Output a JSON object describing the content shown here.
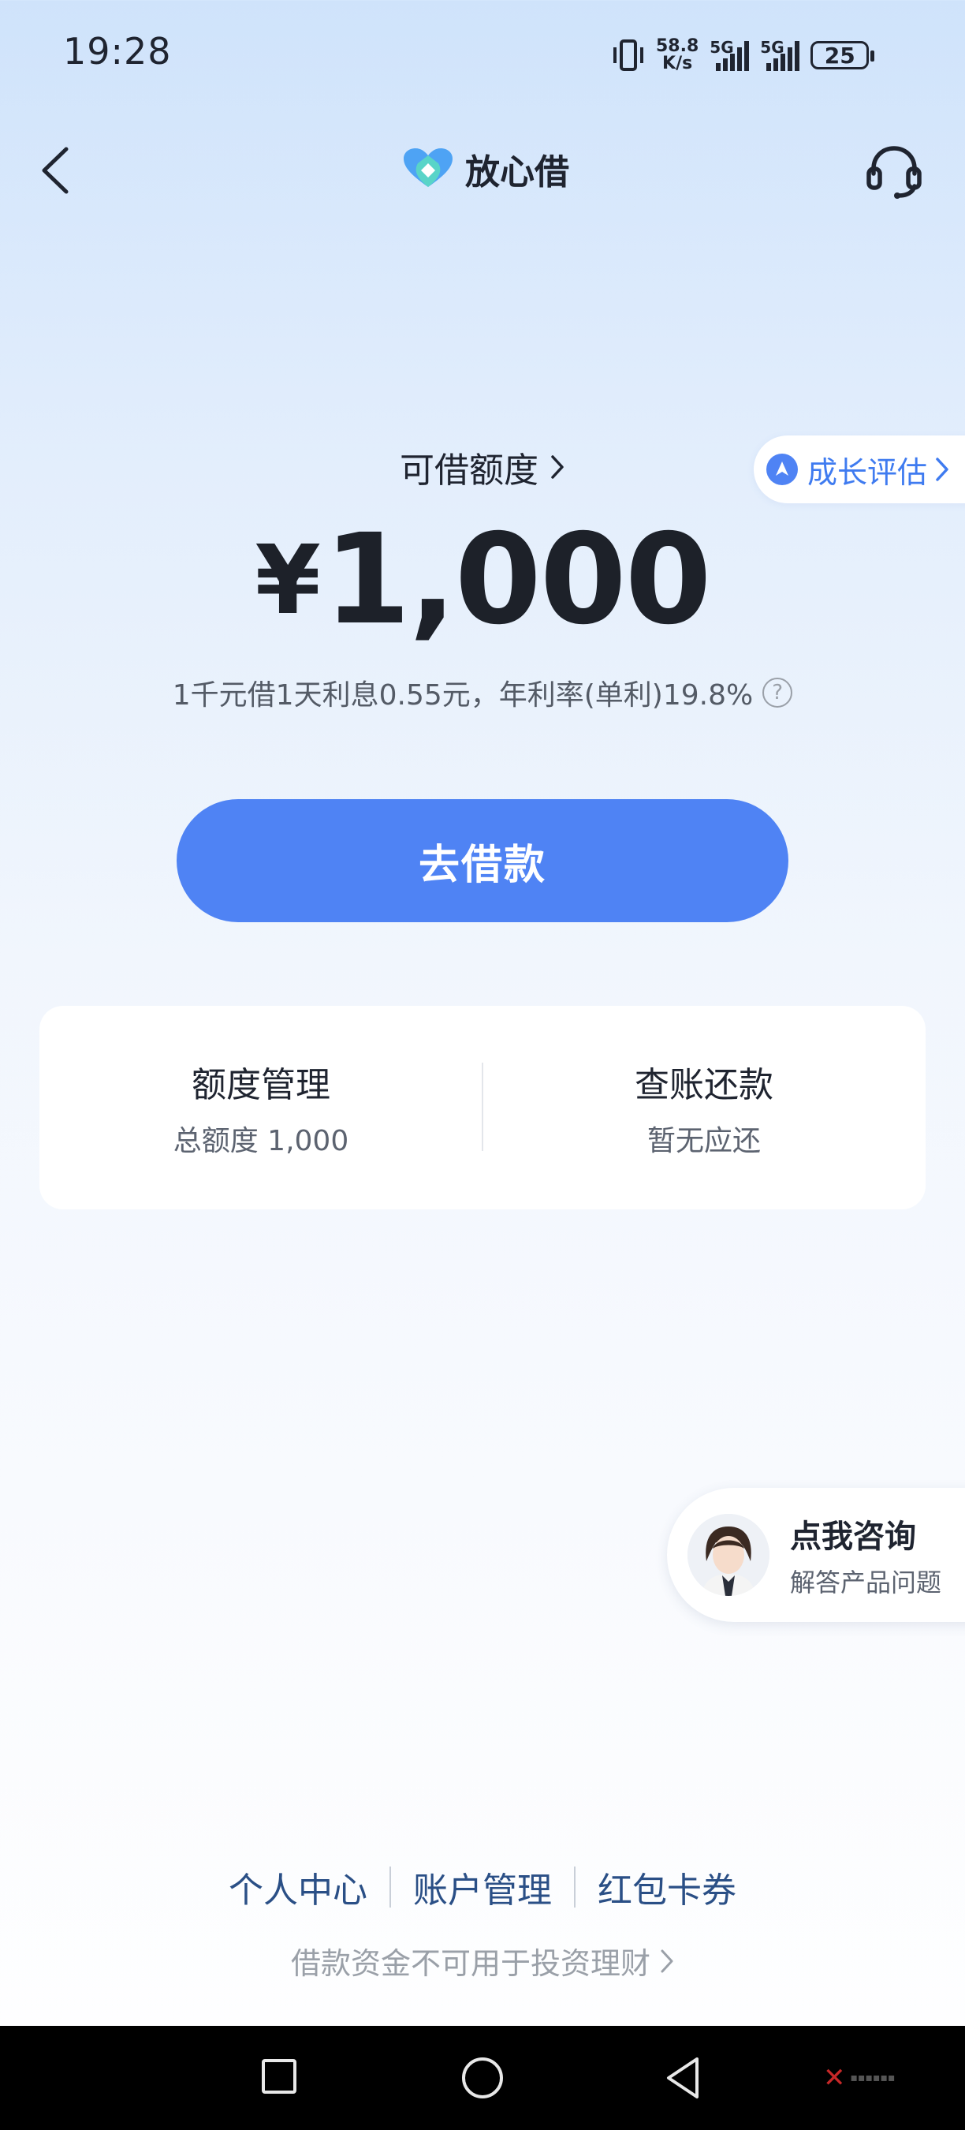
{
  "status_bar": {
    "time": "19:28",
    "net_speed_value": "58.8",
    "net_speed_unit": "K/s",
    "sim1_tag": "5G",
    "sim2_tag": "5G",
    "battery": "25"
  },
  "nav": {
    "back_icon": "chevron-left-icon",
    "brand_name": "放心借",
    "service_icon": "headset-icon"
  },
  "credit": {
    "title": "可借额度",
    "amount": "1,000",
    "currency_symbol": "¥",
    "rate_note": "1千元借1天利息0.55元，年利率(单利)19.8%",
    "help_icon_text": "?"
  },
  "growth_badge": {
    "label": "成长评估"
  },
  "actions": {
    "borrow_label": "去借款"
  },
  "card": {
    "left_title": "额度管理",
    "left_sub": "总额度 1,000",
    "right_title": "查账还款",
    "right_sub": "暂无应还"
  },
  "consult": {
    "title": "点我咨询",
    "subtitle": "解答产品问题"
  },
  "footer": {
    "links": [
      "个人中心",
      "账户管理",
      "红包卡券"
    ],
    "disclaimer": "借款资金不可用于投资理财"
  },
  "colors": {
    "accent": "#4f83f4",
    "link": "#2a4f86",
    "growth": "#3f7bf0"
  }
}
